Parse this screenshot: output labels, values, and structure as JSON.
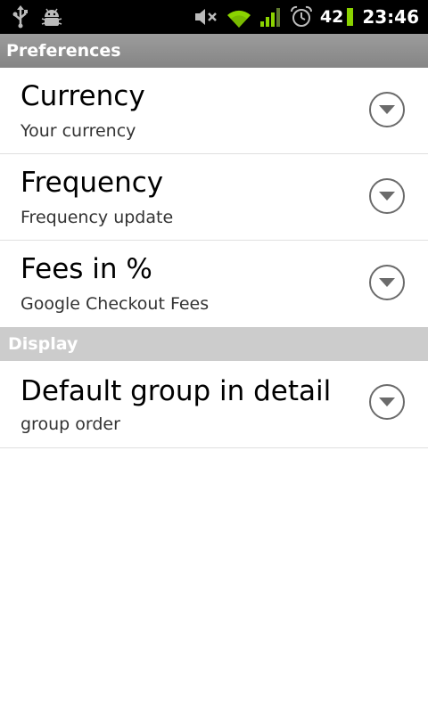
{
  "status_bar": {
    "icons_left": [
      "usb-icon",
      "android-debug-icon"
    ],
    "icons_right": [
      "mute-icon",
      "wifi-icon",
      "signal-icon",
      "alarm-icon"
    ],
    "battery_level": "42",
    "time": "23:46",
    "battery_color": "#8bd300"
  },
  "sections": [
    {
      "title": "Preferences",
      "items": [
        {
          "title": "Currency",
          "summary": "Your currency"
        },
        {
          "title": "Frequency",
          "summary": "Frequency update"
        },
        {
          "title": "Fees in %",
          "summary": "Google Checkout Fees"
        }
      ]
    },
    {
      "title": "Display",
      "items": [
        {
          "title": "Default group in detail",
          "summary": "group order"
        }
      ]
    }
  ]
}
